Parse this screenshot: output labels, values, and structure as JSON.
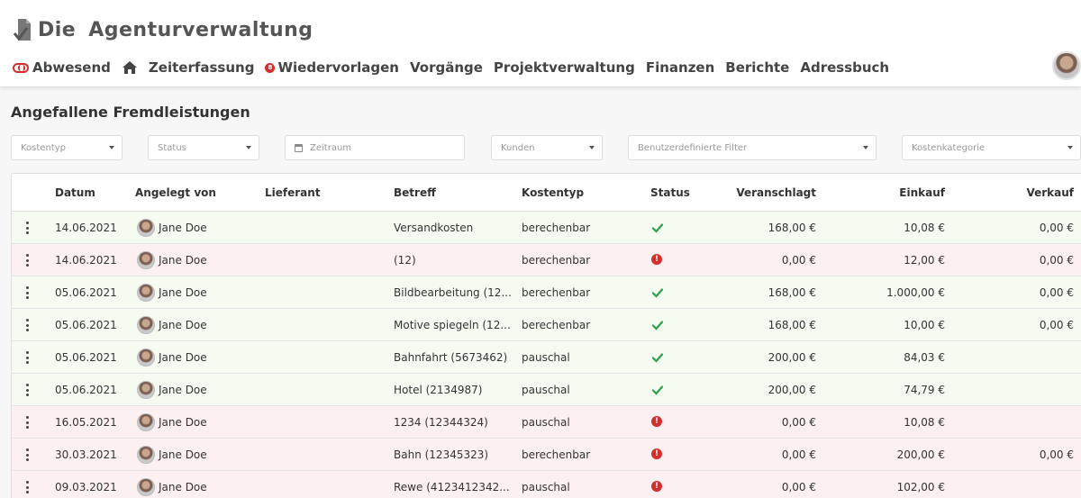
{
  "app": {
    "logo_word1": "Die",
    "logo_word2": "Agenturverwaltung"
  },
  "nav": {
    "absent": "Abwesend",
    "time": "Zeiterfassung",
    "followups": "Wiedervorlagen",
    "followups_badge": "8",
    "processes": "Vorgänge",
    "projects": "Projektverwaltung",
    "finance": "Finanzen",
    "reports": "Berichte",
    "addresses": "Adressbuch"
  },
  "page": {
    "title": "Angefallene Fremdleistungen"
  },
  "filters": {
    "kostentyp": "Kostentyp",
    "status": "Status",
    "zeitraum": "Zeitraum",
    "kunden": "Kunden",
    "custom": "Benutzerdefinierte Filter",
    "kostenkategorie": "Kostenkategorie"
  },
  "table": {
    "headers": {
      "datum": "Datum",
      "angelegt": "Angelegt von",
      "lieferant": "Lieferant",
      "betreff": "Betreff",
      "kostentyp": "Kostentyp",
      "status": "Status",
      "veranschlagt": "Veranschlagt",
      "einkauf": "Einkauf",
      "verkauf": "Verkauf"
    },
    "rows": [
      {
        "datum": "14.06.2021",
        "user": "Jane Doe",
        "lieferant": "",
        "betreff": "Versandkosten",
        "kostentyp": "berechenbar",
        "status": "ok",
        "veranschlagt": "168,00 €",
        "einkauf": "10,08 €",
        "verkauf": "0,00 €"
      },
      {
        "datum": "14.06.2021",
        "user": "Jane Doe",
        "lieferant": "",
        "betreff": "(12)",
        "kostentyp": "berechenbar",
        "status": "err",
        "veranschlagt": "0,00 €",
        "einkauf": "12,00 €",
        "verkauf": "0,00 €"
      },
      {
        "datum": "05.06.2021",
        "user": "Jane Doe",
        "lieferant": "",
        "betreff": "Bildbearbeitung (12...",
        "kostentyp": "berechenbar",
        "status": "ok",
        "veranschlagt": "168,00 €",
        "einkauf": "1.000,00 €",
        "verkauf": "0,00 €"
      },
      {
        "datum": "05.06.2021",
        "user": "Jane Doe",
        "lieferant": "",
        "betreff": "Motive spiegeln (12...",
        "kostentyp": "berechenbar",
        "status": "ok",
        "veranschlagt": "168,00 €",
        "einkauf": "10,00 €",
        "verkauf": "0,00 €"
      },
      {
        "datum": "05.06.2021",
        "user": "Jane Doe",
        "lieferant": "",
        "betreff": "Bahnfahrt (5673462)",
        "kostentyp": "pauschal",
        "status": "ok",
        "veranschlagt": "200,00 €",
        "einkauf": "84,03 €",
        "verkauf": ""
      },
      {
        "datum": "05.06.2021",
        "user": "Jane Doe",
        "lieferant": "",
        "betreff": "Hotel (2134987)",
        "kostentyp": "pauschal",
        "status": "ok",
        "veranschlagt": "200,00 €",
        "einkauf": "74,79 €",
        "verkauf": ""
      },
      {
        "datum": "16.05.2021",
        "user": "Jane Doe",
        "lieferant": "",
        "betreff": "1234 (12344324)",
        "kostentyp": "pauschal",
        "status": "err",
        "veranschlagt": "0,00 €",
        "einkauf": "10,08 €",
        "verkauf": ""
      },
      {
        "datum": "30.03.2021",
        "user": "Jane Doe",
        "lieferant": "",
        "betreff": "Bahn (12345323)",
        "kostentyp": "berechenbar",
        "status": "err",
        "veranschlagt": "0,00 €",
        "einkauf": "200,00 €",
        "verkauf": "0,00 €"
      },
      {
        "datum": "09.03.2021",
        "user": "Jane Doe",
        "lieferant": "",
        "betreff": "Rewe (4123412342...",
        "kostentyp": "pauschal",
        "status": "err",
        "veranschlagt": "0,00 €",
        "einkauf": "102,00 €",
        "verkauf": ""
      }
    ]
  },
  "icons": {
    "status_ok": "checkmark-icon",
    "status_err": "exclamation-circle-icon",
    "row_menu": "vertical-dots-icon"
  },
  "colors": {
    "ok": "#2e9e4f",
    "error": "#d32f2f",
    "row_ok_bg": "#f6fbf2",
    "row_err_bg": "#fdf0f0"
  }
}
